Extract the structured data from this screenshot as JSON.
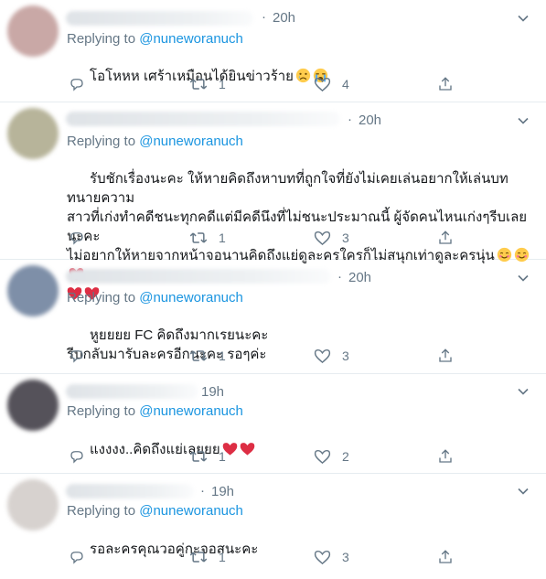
{
  "tweets": [
    {
      "time": "20h",
      "replying_prefix": "Replying to",
      "handle": "@nuneworanuch",
      "text": "โอโหหห เศร้าเหมือนได้ยินข่าวร้าย",
      "emojis": [
        "crying-face",
        "loudly-crying-face"
      ],
      "reply_count": "",
      "retweet_count": "1",
      "like_count": "4",
      "avatar_color": "#c9a8a6"
    },
    {
      "time": "20h",
      "replying_prefix": "Replying to",
      "handle": "@nuneworanuch",
      "text": "รับชักเรื่องนะคะ ให้หายคิดถึงหาบทที่ถูกใจที่ยังไม่เคยเล่นอยากให้เล่นบททนายความ\nสาวที่เก่งทำคดีชนะทุกคดีแต่มีคดีนึงที่ไม่ชนะประมาณนี้ ผู้จัดคนไหนเก่งๆรีบเลยนะคะ\nไม่อยากให้หายจากหน้าจอนานคิดถึงแย่ดูละครใครก็ไม่สนุกเท่าดูละครนุ่น",
      "emojis": [
        "smiling-face",
        "smiling-face",
        "red-heart",
        "red-heart",
        "red-heart"
      ],
      "reply_count": "",
      "retweet_count": "1",
      "like_count": "3",
      "avatar_color": "#b7b49a"
    },
    {
      "time": "20h",
      "replying_prefix": "Replying to",
      "handle": "@nuneworanuch",
      "text": "หูยยยย FC คิดถึงมากเรยนะคะ\nรีบกลับมารับละครอีกนะคะ รอๆค่ะ",
      "emojis": [],
      "reply_count": "",
      "retweet_count": "1",
      "like_count": "3",
      "avatar_color": "#7e8fa8"
    },
    {
      "time": "19h",
      "replying_prefix": "Replying to",
      "handle": "@nuneworanuch",
      "text": "แงงงง..คิดถึงแย่เลยยย",
      "emojis": [
        "red-heart",
        "red-heart"
      ],
      "reply_count": "",
      "retweet_count": "1",
      "like_count": "2",
      "avatar_color": "#55525a"
    },
    {
      "time": "19h",
      "replying_prefix": "Replying to",
      "handle": "@nuneworanuch",
      "text": "รอละครคุณวอคู่กะจอสนะคะ",
      "emojis": [],
      "reply_count": "",
      "retweet_count": "1",
      "like_count": "3",
      "avatar_color": "#d7d2cf"
    }
  ]
}
